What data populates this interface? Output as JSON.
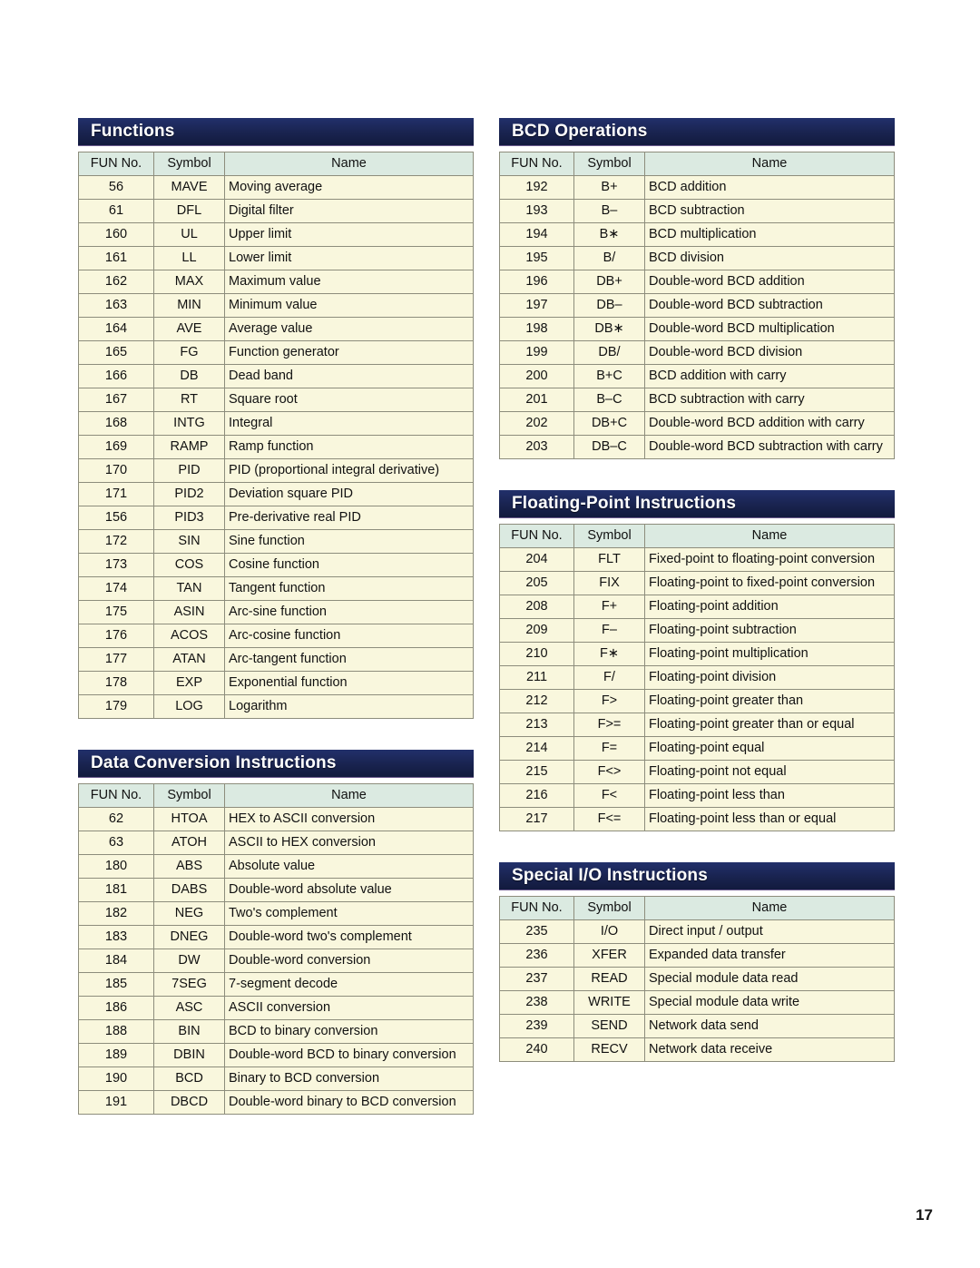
{
  "page": {
    "number": "17",
    "background_color": "#ffffff",
    "header_bar_color": "#19234f",
    "table_header_color": "#dbeae1",
    "table_row_color": "#f9f7dd"
  },
  "columns": {
    "header_fun": "FUN No.",
    "header_symbol": "Symbol",
    "header_name": "Name"
  },
  "sections": [
    {
      "id": "functions",
      "title": "Functions",
      "column": "left",
      "rows": [
        {
          "fun": "56",
          "symbol": "MAVE",
          "name": "Moving average"
        },
        {
          "fun": "61",
          "symbol": "DFL",
          "name": "Digital filter"
        },
        {
          "fun": "160",
          "symbol": "UL",
          "name": "Upper limit"
        },
        {
          "fun": "161",
          "symbol": "LL",
          "name": "Lower limit"
        },
        {
          "fun": "162",
          "symbol": "MAX",
          "name": "Maximum value"
        },
        {
          "fun": "163",
          "symbol": "MIN",
          "name": "Minimum value"
        },
        {
          "fun": "164",
          "symbol": "AVE",
          "name": "Average value"
        },
        {
          "fun": "165",
          "symbol": "FG",
          "name": "Function generator"
        },
        {
          "fun": "166",
          "symbol": "DB",
          "name": "Dead band"
        },
        {
          "fun": "167",
          "symbol": "RT",
          "name": "Square root"
        },
        {
          "fun": "168",
          "symbol": "INTG",
          "name": "Integral"
        },
        {
          "fun": "169",
          "symbol": "RAMP",
          "name": "Ramp function"
        },
        {
          "fun": "170",
          "symbol": "PID",
          "name": "PID (proportional integral derivative)"
        },
        {
          "fun": "171",
          "symbol": "PID2",
          "name": "Deviation square PID"
        },
        {
          "fun": "156",
          "symbol": "PID3",
          "name": "Pre-derivative real PID"
        },
        {
          "fun": "172",
          "symbol": "SIN",
          "name": "Sine function"
        },
        {
          "fun": "173",
          "symbol": "COS",
          "name": "Cosine function"
        },
        {
          "fun": "174",
          "symbol": "TAN",
          "name": "Tangent function"
        },
        {
          "fun": "175",
          "symbol": "ASIN",
          "name": "Arc-sine function"
        },
        {
          "fun": "176",
          "symbol": "ACOS",
          "name": "Arc-cosine function"
        },
        {
          "fun": "177",
          "symbol": "ATAN",
          "name": "Arc-tangent function"
        },
        {
          "fun": "178",
          "symbol": "EXP",
          "name": "Exponential function"
        },
        {
          "fun": "179",
          "symbol": "LOG",
          "name": "Logarithm"
        }
      ]
    },
    {
      "id": "data-conversion-instructions",
      "title": "Data Conversion Instructions",
      "column": "left",
      "rows": [
        {
          "fun": "62",
          "symbol": "HTOA",
          "name": "HEX to ASCII conversion"
        },
        {
          "fun": "63",
          "symbol": "ATOH",
          "name": "ASCII to HEX conversion"
        },
        {
          "fun": "180",
          "symbol": "ABS",
          "name": "Absolute value"
        },
        {
          "fun": "181",
          "symbol": "DABS",
          "name": "Double-word absolute value"
        },
        {
          "fun": "182",
          "symbol": "NEG",
          "name": "Two's complement"
        },
        {
          "fun": "183",
          "symbol": "DNEG",
          "name": "Double-word two's complement"
        },
        {
          "fun": "184",
          "symbol": "DW",
          "name": "Double-word conversion"
        },
        {
          "fun": "185",
          "symbol": "7SEG",
          "name": "7-segment decode"
        },
        {
          "fun": "186",
          "symbol": "ASC",
          "name": "ASCII conversion"
        },
        {
          "fun": "188",
          "symbol": "BIN",
          "name": "BCD to binary conversion"
        },
        {
          "fun": "189",
          "symbol": "DBIN",
          "name": "Double-word BCD to binary conversion"
        },
        {
          "fun": "190",
          "symbol": "BCD",
          "name": "Binary to BCD conversion"
        },
        {
          "fun": "191",
          "symbol": "DBCD",
          "name": "Double-word binary to BCD conversion"
        }
      ]
    },
    {
      "id": "bcd-operations",
      "title": "BCD Operations",
      "column": "right",
      "rows": [
        {
          "fun": "192",
          "symbol": "B+",
          "name": "BCD addition"
        },
        {
          "fun": "193",
          "symbol": "B–",
          "name": "BCD subtraction"
        },
        {
          "fun": "194",
          "symbol": "B∗",
          "name": "BCD multiplication"
        },
        {
          "fun": "195",
          "symbol": "B/",
          "name": "BCD division"
        },
        {
          "fun": "196",
          "symbol": "DB+",
          "name": "Double-word BCD addition"
        },
        {
          "fun": "197",
          "symbol": "DB–",
          "name": "Double-word BCD subtraction"
        },
        {
          "fun": "198",
          "symbol": "DB∗",
          "name": "Double-word BCD multiplication"
        },
        {
          "fun": "199",
          "symbol": "DB/",
          "name": "Double-word BCD division"
        },
        {
          "fun": "200",
          "symbol": "B+C",
          "name": "BCD addition with carry"
        },
        {
          "fun": "201",
          "symbol": "B–C",
          "name": "BCD subtraction with carry"
        },
        {
          "fun": "202",
          "symbol": "DB+C",
          "name": "Double-word BCD addition with carry"
        },
        {
          "fun": "203",
          "symbol": "DB–C",
          "name": "Double-word BCD subtraction with carry"
        }
      ]
    },
    {
      "id": "floating-point-instructions",
      "title": "Floating-Point Instructions",
      "column": "right",
      "rows": [
        {
          "fun": "204",
          "symbol": "FLT",
          "name": "Fixed-point to floating-point conversion"
        },
        {
          "fun": "205",
          "symbol": "FIX",
          "name": "Floating-point to fixed-point conversion"
        },
        {
          "fun": "208",
          "symbol": "F+",
          "name": "Floating-point addition"
        },
        {
          "fun": "209",
          "symbol": "F–",
          "name": "Floating-point subtraction"
        },
        {
          "fun": "210",
          "symbol": "F∗",
          "name": "Floating-point multiplication"
        },
        {
          "fun": "211",
          "symbol": "F/",
          "name": "Floating-point division"
        },
        {
          "fun": "212",
          "symbol": "F>",
          "name": "Floating-point greater than"
        },
        {
          "fun": "213",
          "symbol": "F>=",
          "name": "Floating-point greater than or equal"
        },
        {
          "fun": "214",
          "symbol": "F=",
          "name": "Floating-point equal"
        },
        {
          "fun": "215",
          "symbol": "F<>",
          "name": "Floating-point not equal"
        },
        {
          "fun": "216",
          "symbol": "F<",
          "name": "Floating-point less than"
        },
        {
          "fun": "217",
          "symbol": "F<=",
          "name": "Floating-point less than or equal"
        }
      ]
    },
    {
      "id": "special-io-instructions",
      "title": "Special I/O Instructions",
      "column": "right",
      "rows": [
        {
          "fun": "235",
          "symbol": "I/O",
          "name": "Direct input / output"
        },
        {
          "fun": "236",
          "symbol": "XFER",
          "name": "Expanded data transfer"
        },
        {
          "fun": "237",
          "symbol": "READ",
          "name": "Special module data read"
        },
        {
          "fun": "238",
          "symbol": "WRITE",
          "name": "Special module data write"
        },
        {
          "fun": "239",
          "symbol": "SEND",
          "name": "Network data send"
        },
        {
          "fun": "240",
          "symbol": "RECV",
          "name": "Network data receive"
        }
      ]
    }
  ]
}
